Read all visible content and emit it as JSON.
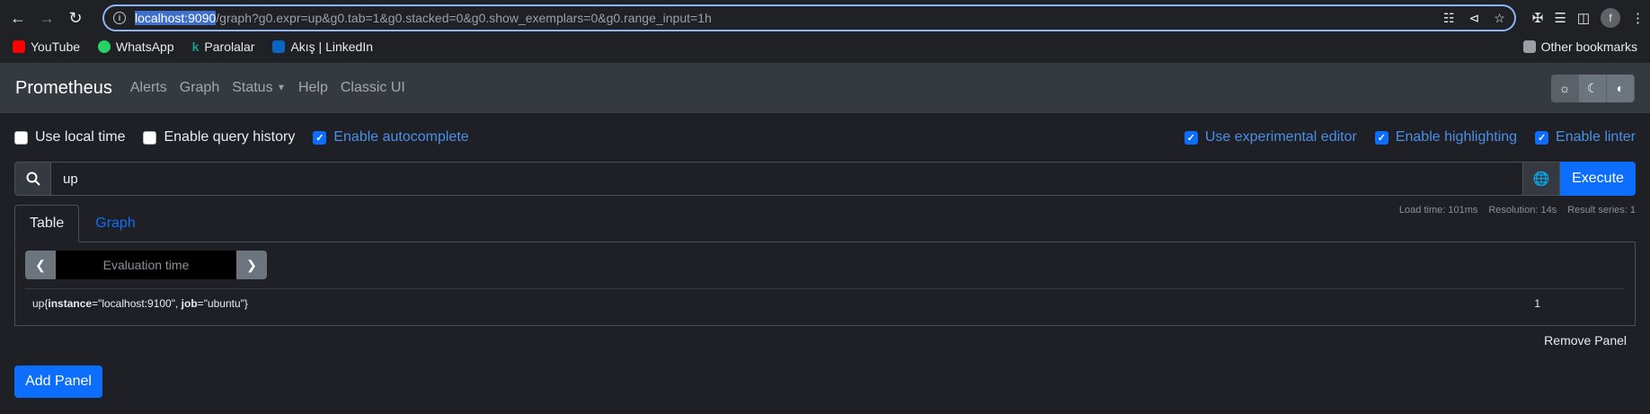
{
  "browser": {
    "url_host": "localhost:9090",
    "url_path": "/graph?g0.expr=up&g0.tab=1&g0.stacked=0&g0.show_exemplars=0&g0.range_input=1h",
    "avatar_letter": "f"
  },
  "bookmarks": [
    {
      "label": "YouTube",
      "icon": "youtube-icon",
      "color": "#ff0000"
    },
    {
      "label": "WhatsApp",
      "icon": "whatsapp-icon",
      "color": "#25d366"
    },
    {
      "label": "Parolalar",
      "icon": "k-icon",
      "color": "#1a9c8c"
    },
    {
      "label": "Akış | LinkedIn",
      "icon": "linkedin-icon",
      "color": "#0a66c2"
    }
  ],
  "other_bookmarks": "Other bookmarks",
  "nav": {
    "brand": "Prometheus",
    "links": [
      "Alerts",
      "Graph",
      "Status",
      "Help",
      "Classic UI"
    ]
  },
  "options": {
    "use_local_time": {
      "label": "Use local time",
      "checked": false
    },
    "query_history": {
      "label": "Enable query history",
      "checked": false
    },
    "autocomplete": {
      "label": "Enable autocomplete",
      "checked": true
    },
    "experimental_editor": {
      "label": "Use experimental editor",
      "checked": true
    },
    "highlighting": {
      "label": "Enable highlighting",
      "checked": true
    },
    "linter": {
      "label": "Enable linter",
      "checked": true
    }
  },
  "query": {
    "expression": "up",
    "execute_label": "Execute"
  },
  "tabs": {
    "table": "Table",
    "graph": "Graph"
  },
  "stats": {
    "load_time": "Load time: 101ms",
    "resolution": "Resolution: 14s",
    "result_series": "Result series: 1"
  },
  "eval_placeholder": "Evaluation time",
  "result": {
    "metric": "up",
    "label1_key": "instance",
    "label1_value": "\"localhost:9100\"",
    "label2_key": "job",
    "label2_value": "\"ubuntu\"",
    "value": "1"
  },
  "remove_panel": "Remove Panel",
  "add_panel": "Add Panel",
  "colors": {
    "accent": "#0d6efd",
    "navbar": "#343a40",
    "background": "#1e2025"
  }
}
